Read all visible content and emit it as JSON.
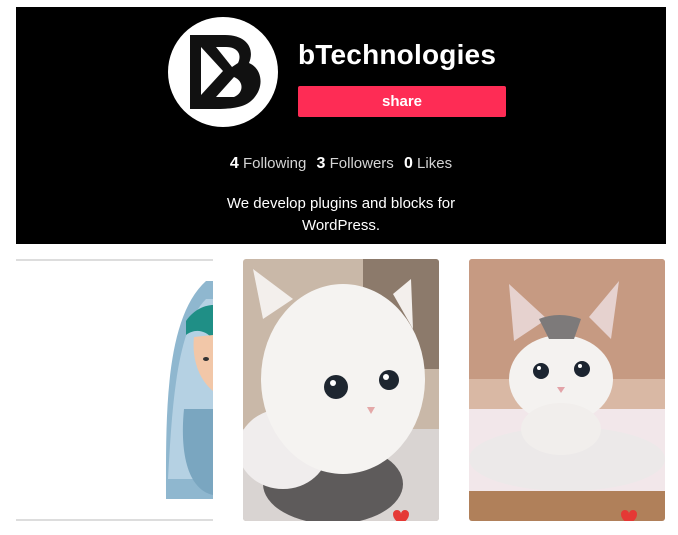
{
  "profile": {
    "username": "bTechnologies",
    "share_label": "share",
    "stats": [
      {
        "count": "4",
        "label": "Following"
      },
      {
        "count": "3",
        "label": "Followers"
      },
      {
        "count": "0",
        "label": "Likes"
      }
    ],
    "bio": "We develop plugins and blocks for WordPress."
  },
  "videos": [
    {
      "subject": "hijab-woman-illustration"
    },
    {
      "subject": "white-kitten"
    },
    {
      "subject": "grey-white-kitten"
    }
  ],
  "colors": {
    "header_background": "#000000",
    "share_button": "#fe2c55",
    "text_primary": "#ffffff",
    "text_secondary": "#d4d4d4"
  }
}
